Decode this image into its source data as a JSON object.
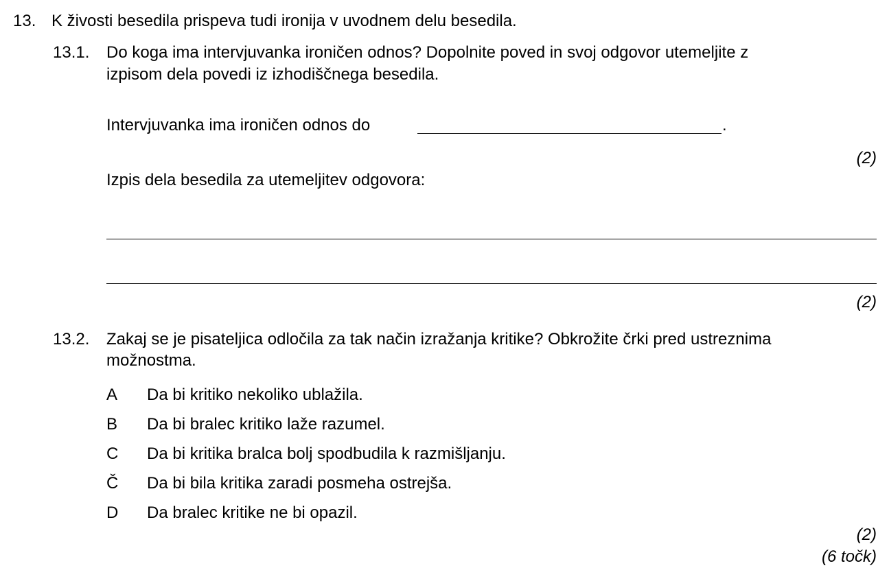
{
  "question": {
    "number": "13.",
    "text": "K živosti besedila prispeva tudi ironija v uvodnem delu besedila.",
    "total_points": "(6 točk)"
  },
  "sub1": {
    "number": "13.1.",
    "text_line1": "Do koga ima intervjuvanka ironičen odnos? Dopolnite poved in svoj odgovor utemeljite z",
    "text_line2": "izpisom dela povedi iz izhodiščnega besedila.",
    "fill_prefix": "Intervjuvanka ima ironičen odnos do",
    "fill_suffix": ".",
    "fill_points": "(2)",
    "citation_label": "Izpis dela besedila za utemeljitev odgovora:",
    "citation_points": "(2)"
  },
  "sub2": {
    "number": "13.2.",
    "text_line1": "Zakaj se je pisateljica odločila za tak način izražanja kritike? Obkrožite črki pred ustreznima",
    "text_line2": "možnostma.",
    "options": [
      {
        "letter": "A",
        "text": "Da bi kritiko nekoliko ublažila."
      },
      {
        "letter": "B",
        "text": "Da bi bralec kritiko laže razumel."
      },
      {
        "letter": "C",
        "text": "Da bi kritika bralca bolj spodbudila k razmišljanju."
      },
      {
        "letter": "Č",
        "text": "Da bi bila kritika zaradi posmeha ostrejša."
      },
      {
        "letter": "D",
        "text": "Da bralec kritike ne bi opazil."
      }
    ],
    "points": "(2)"
  }
}
